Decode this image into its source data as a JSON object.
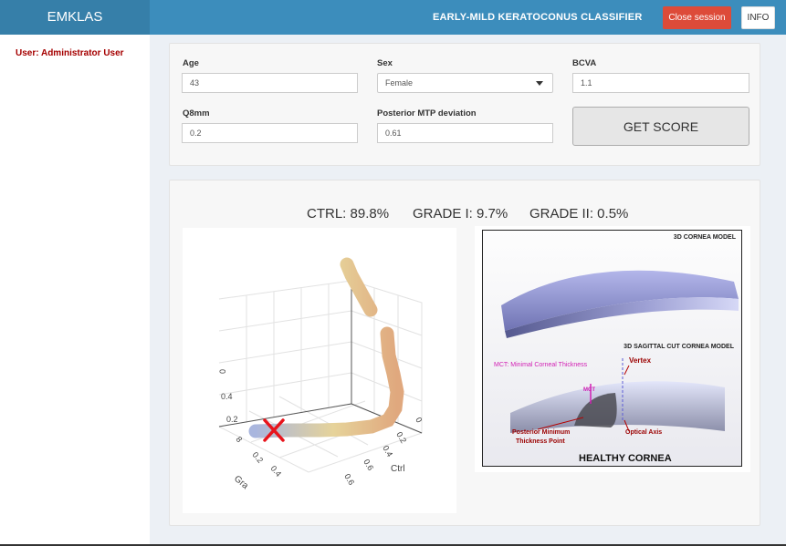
{
  "header": {
    "brand": "EMKLAS",
    "title": "EARLY-MILD KERATOCONUS CLASSIFIER",
    "close_label": "Close session",
    "info_label": "INFO"
  },
  "sidebar": {
    "user": "User: Administrator User"
  },
  "form": {
    "age_label": "Age",
    "age_value": "43",
    "sex_label": "Sex",
    "sex_value": "Female",
    "bcva_label": "BCVA",
    "bcva_value": "1.1",
    "q8_label": "Q8mm",
    "q8_value": "0.2",
    "mtp_label": "Posterior MTP deviation",
    "mtp_value": "0.61",
    "score_label": "GET SCORE"
  },
  "result": {
    "ctrl": "CTRL: 89.8%",
    "grade1": "GRADE I: 9.7%",
    "grade2": "GRADE II: 0.5%"
  },
  "plot3d": {
    "axis_ctrl_label": "Ctrl",
    "axis_grade_label": "Gra",
    "ctrl_ticks": [
      "0",
      "0.2",
      "0.4",
      "0.6"
    ],
    "grade_ticks": [
      "0.2",
      "0.4",
      "0.6"
    ],
    "vertical_ticks": [
      "0.2",
      "0.4",
      "0"
    ],
    "marker_color": "#e8141c",
    "curve_start_color": "#a9b6de",
    "curve_end_color": "#e0a87e"
  },
  "cornea_image": {
    "model3d": "3D CORNEA MODEL",
    "sagittal": "3D SAGITTAL CUT CORNEA MODEL",
    "mct": "MCT: Minimal Corneal Thickness",
    "vertex": "Vertex",
    "mct_short": "MCT",
    "optical_axis": "Optical Axis",
    "pmtp": "Posterior Minimum",
    "pmtp2": "Thickness Point",
    "healthy": "HEALTHY CORNEA"
  }
}
